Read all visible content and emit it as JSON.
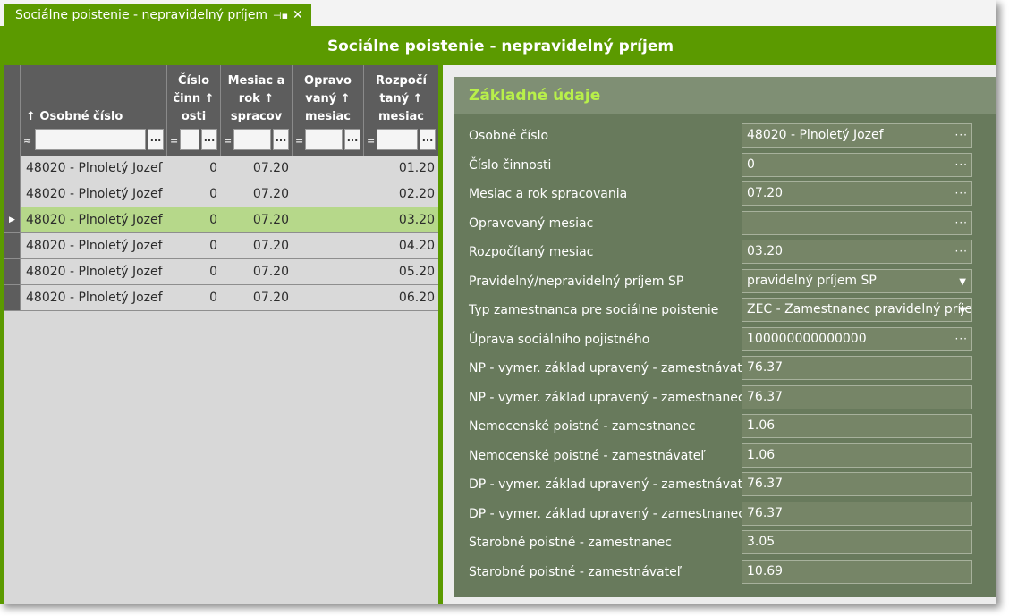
{
  "window": {
    "tab_title": "Sociálne poistenie - nepravidelný príjem",
    "pin_icon": "pin-icon",
    "close_icon": "close-icon",
    "title": "Sociálne poistenie - nepravidelný príjem"
  },
  "grid": {
    "columns": [
      {
        "label": "↑ Osobné číslo",
        "filter_op": "≈"
      },
      {
        "label": "Číslo činn ↑ osti",
        "filter_op": "="
      },
      {
        "label": "Mesiac a rok ↑ spracov",
        "filter_op": "="
      },
      {
        "label": "Opravo vaný ↑ mesiac",
        "filter_op": "="
      },
      {
        "label": "Rozpočí taný ↑ mesiac",
        "filter_op": "="
      }
    ],
    "filter_button": "...",
    "row_indicator": "▶",
    "rows": [
      {
        "osobne_cislo": "48020 - Plnoletý Jozef",
        "cislo_cinnosti": "0",
        "mesiac_rok": "07.20",
        "opraveny": "",
        "rozpocitany": "01.20"
      },
      {
        "osobne_cislo": "48020 - Plnoletý Jozef",
        "cislo_cinnosti": "0",
        "mesiac_rok": "07.20",
        "opraveny": "",
        "rozpocitany": "02.20"
      },
      {
        "osobne_cislo": "48020 - Plnoletý Jozef",
        "cislo_cinnosti": "0",
        "mesiac_rok": "07.20",
        "opraveny": "",
        "rozpocitany": "03.20"
      },
      {
        "osobne_cislo": "48020 - Plnoletý Jozef",
        "cislo_cinnosti": "0",
        "mesiac_rok": "07.20",
        "opraveny": "",
        "rozpocitany": "04.20"
      },
      {
        "osobne_cislo": "48020 - Plnoletý Jozef",
        "cislo_cinnosti": "0",
        "mesiac_rok": "07.20",
        "opraveny": "",
        "rozpocitany": "05.20"
      },
      {
        "osobne_cislo": "48020 - Plnoletý Jozef",
        "cislo_cinnosti": "0",
        "mesiac_rok": "07.20",
        "opraveny": "",
        "rozpocitany": "06.20"
      }
    ],
    "selected_row": 2
  },
  "detail": {
    "title": "Základné údaje",
    "lookup_button": "···",
    "dropdown_icon": "▼",
    "fields": [
      {
        "label": "Osobné číslo",
        "value": "48020 - Plnoletý Jozef",
        "kind": "lookup"
      },
      {
        "label": "Číslo činnosti",
        "value": "0",
        "kind": "lookup"
      },
      {
        "label": "Mesiac a rok spracovania",
        "value": "07.20",
        "kind": "lookup"
      },
      {
        "label": "Opravovaný mesiac",
        "value": "",
        "kind": "lookup"
      },
      {
        "label": "Rozpočítaný mesiac",
        "value": "03.20",
        "kind": "lookup"
      },
      {
        "label": "Pravidelný/nepravidelný príjem SP",
        "value": "pravidelný príjem SP",
        "kind": "dropdown"
      },
      {
        "label": "Typ zamestnanca pre sociálne poistenie",
        "value": "ZEC - Zamestnanec pravidelný príje",
        "kind": "dropdown"
      },
      {
        "label": "Úprava sociálního pojistného",
        "value": "100000000000000",
        "kind": "lookup"
      },
      {
        "label": "NP - vymer. základ upravený - zamestnávateľ",
        "value": "76.37",
        "kind": "text"
      },
      {
        "label": "NP - vymer. základ upravený - zamestnanec",
        "value": "76.37",
        "kind": "text"
      },
      {
        "label": "Nemocenské poistné - zamestnanec",
        "value": "1.06",
        "kind": "text"
      },
      {
        "label": "Nemocenské poistné - zamestnávateľ",
        "value": "1.06",
        "kind": "text"
      },
      {
        "label": "DP - vymer. základ upravený - zamestnávateľ",
        "value": "76.37",
        "kind": "text"
      },
      {
        "label": "DP - vymer. základ upravený - zamestnanec",
        "value": "76.37",
        "kind": "text"
      },
      {
        "label": "Starobné poistné - zamestnanec",
        "value": "3.05",
        "kind": "text"
      },
      {
        "label": "Starobné poistné - zamestnávateľ",
        "value": "10.69",
        "kind": "text"
      }
    ]
  },
  "colors": {
    "accent": "#5b9a00",
    "selected_row": "#b6d88a",
    "panel": "#687a5c",
    "panel_title": "#b8f04a"
  }
}
